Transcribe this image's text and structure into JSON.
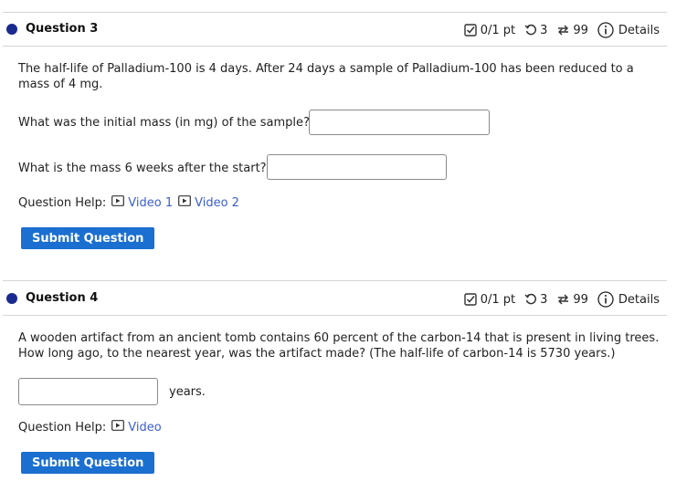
{
  "q3": {
    "title": "Question 3",
    "score": "0/1 pt",
    "retries": "3",
    "attempts": "99",
    "details": "Details",
    "prompt": "The half-life of Palladium-100 is 4 days. After 24 days a sample of Palladium-100 has been reduced to a mass of 4 mg.",
    "q1": "What was the initial mass (in mg) of the sample?",
    "q2": "What is the mass 6 weeks after the start?",
    "help_label": "Question Help:",
    "video1": "Video 1",
    "video2": "Video 2",
    "submit": "Submit Question"
  },
  "q4": {
    "title": "Question 4",
    "score": "0/1 pt",
    "retries": "3",
    "attempts": "99",
    "details": "Details",
    "prompt": "A wooden artifact from an ancient tomb contains 60 percent of the carbon-14 that is present in living trees. How long ago, to the nearest year, was the artifact made? (The half-life of carbon-14 is 5730 years.)",
    "unit": "years.",
    "help_label": "Question Help:",
    "video": "Video",
    "submit": "Submit Question"
  },
  "colors": {
    "accent": "#1a6fd0",
    "dot": "#1b2a8f",
    "link": "#3b5ed1"
  }
}
